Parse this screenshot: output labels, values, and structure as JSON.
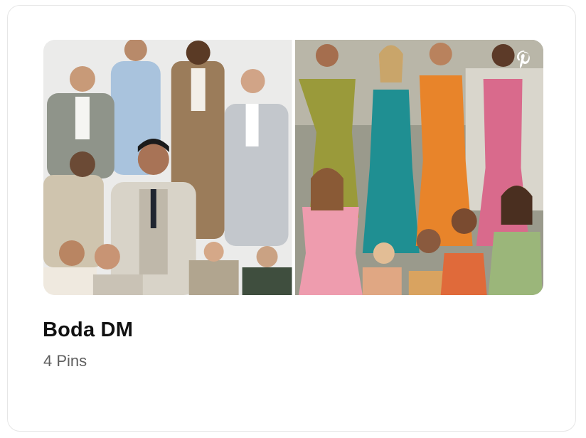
{
  "board": {
    "title": "Boda DM",
    "pin_count_label": "4 Pins"
  },
  "cover": {
    "left_image": "suits-collage",
    "right_image": "dresses-collage",
    "badge_icon": "pinterest-icon"
  },
  "colors": {
    "card_border": "#e6e6e6",
    "title": "#111111",
    "subtitle": "#5f5f5f"
  }
}
